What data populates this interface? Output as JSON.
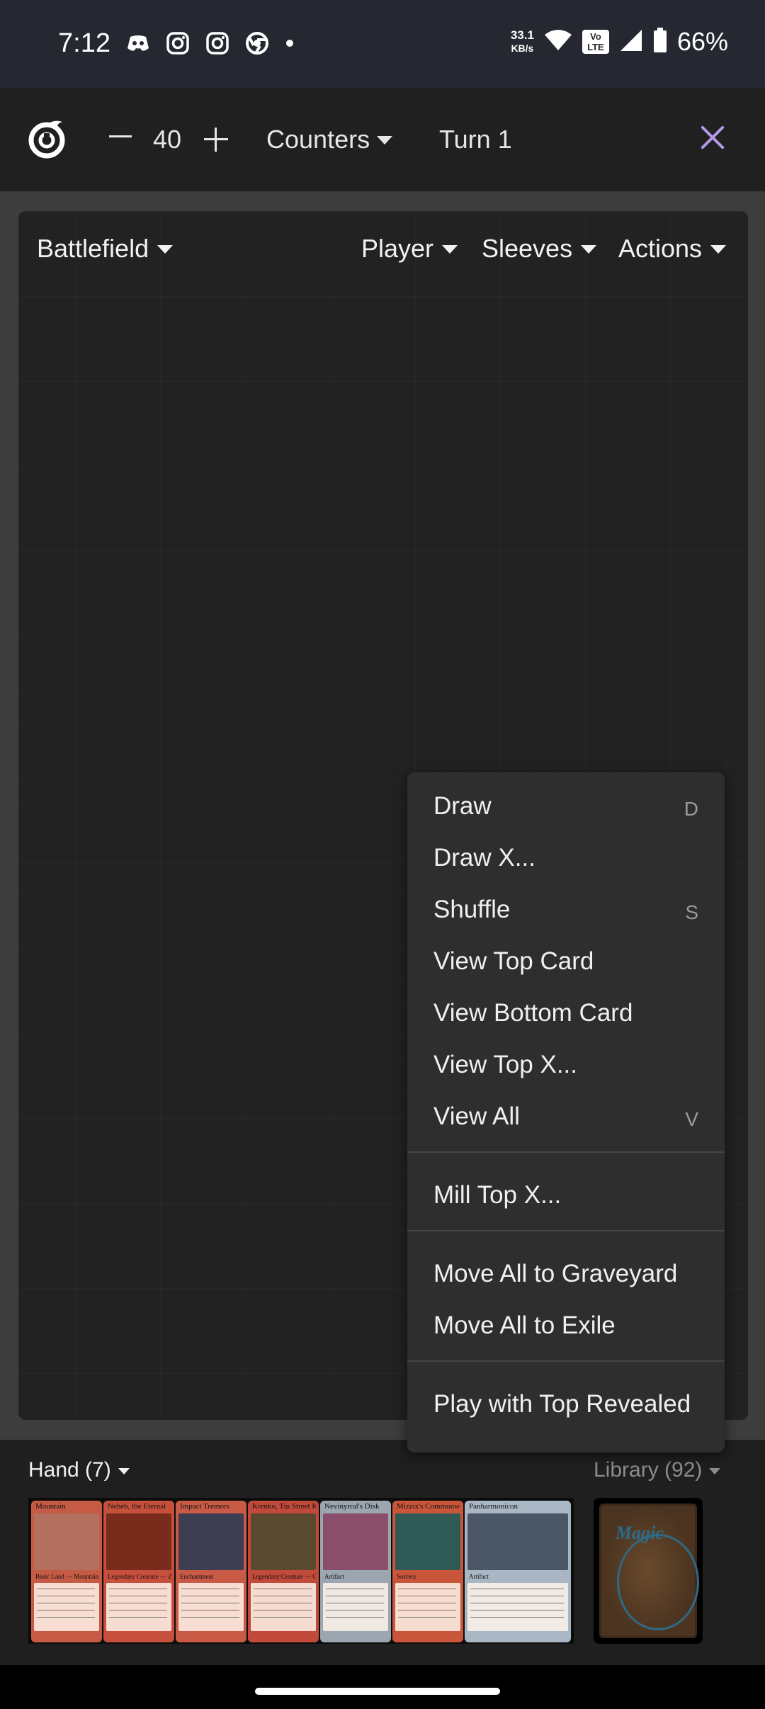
{
  "status_bar": {
    "time": "7:12",
    "net_speed_value": "33.1",
    "net_speed_unit": "KB/s",
    "volte": "Vo LTE",
    "battery": "66%",
    "left_icons": [
      "discord-icon",
      "instagram-icon",
      "instagram-icon",
      "chrome-icon",
      "dot-icon"
    ]
  },
  "app_bar": {
    "life_total": "40",
    "counters_label": "Counters",
    "turn_label": "Turn 1",
    "accent_color": "#b49ae6"
  },
  "battlefield": {
    "zone_label": "Battlefield",
    "tabs": [
      "Player",
      "Sleeves",
      "Actions"
    ]
  },
  "menu": {
    "groups": [
      [
        {
          "label": "Draw",
          "shortcut": "D"
        },
        {
          "label": "Draw X...",
          "shortcut": ""
        },
        {
          "label": "Shuffle",
          "shortcut": "S"
        },
        {
          "label": "View Top Card",
          "shortcut": ""
        },
        {
          "label": "View Bottom Card",
          "shortcut": ""
        },
        {
          "label": "View Top X...",
          "shortcut": ""
        },
        {
          "label": "View All",
          "shortcut": "V"
        }
      ],
      [
        {
          "label": "Mill Top X...",
          "shortcut": ""
        }
      ],
      [
        {
          "label": "Move All to Graveyard",
          "shortcut": ""
        },
        {
          "label": "Move All to Exile",
          "shortcut": ""
        }
      ],
      [
        {
          "label": "Play with Top Revealed",
          "shortcut": ""
        }
      ]
    ],
    "edge_glyph": "s"
  },
  "hand": {
    "label": "Hand (7)",
    "cards": [
      {
        "name": "Mountain",
        "type_line": "Basic Land — Mountain",
        "frame": "#c65b45",
        "art": "#b3705e"
      },
      {
        "name": "Neheb, the Eternal",
        "type_line": "Legendary Creature — Zombie Minotaur",
        "frame": "#c7503c",
        "art": "#7a2c1c"
      },
      {
        "name": "Impact Tremors",
        "type_line": "Enchantment",
        "frame": "#c95a45",
        "art": "#3d3e52"
      },
      {
        "name": "Krenko, Tin Street Kingpin",
        "type_line": "Legendary Creature — Goblin",
        "frame": "#c24a3a",
        "art": "#5a4a30"
      },
      {
        "name": "Nevinyrral's Disk",
        "type_line": "Artifact",
        "frame": "#9ba6b0",
        "art": "#8a4d6a"
      },
      {
        "name": "Mizzix's Commonwealth",
        "type_line": "Sorcery",
        "frame": "#c9553b",
        "art": "#2f5a55"
      },
      {
        "name": "Panharmonicon",
        "type_line": "Artifact",
        "frame": "#a9b6c3",
        "art": "#4a5566"
      }
    ]
  },
  "library": {
    "label": "Library (92)",
    "card_back_title": "Magic"
  }
}
